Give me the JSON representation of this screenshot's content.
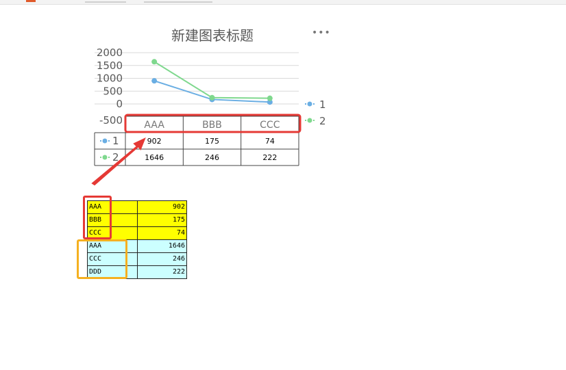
{
  "chart_data": {
    "type": "line",
    "title": "新建图表标题",
    "categories": [
      "AAA",
      "BBB",
      "CCC"
    ],
    "series": [
      {
        "name": "1",
        "values": [
          902,
          175,
          74
        ],
        "color": "#6aaee3"
      },
      {
        "name": "2",
        "values": [
          1646,
          246,
          222
        ],
        "color": "#7fd88e"
      }
    ],
    "y_ticks": [
      "2000",
      "1500",
      "1000",
      "500",
      "0",
      "-500"
    ],
    "ylim": [
      -500,
      2000
    ],
    "grid": true,
    "legend": "right",
    "data_table": true
  },
  "menu": {
    "more": "•••"
  },
  "sheet_table": {
    "rows": [
      {
        "key": "AAA",
        "value": "902",
        "fill": "#ffff00"
      },
      {
        "key": "BBB",
        "value": "175",
        "fill": "#ffff00"
      },
      {
        "key": "CCC",
        "value": "74",
        "fill": "#ffff00"
      },
      {
        "key": "AAA",
        "value": "1646",
        "fill": "#ccffff"
      },
      {
        "key": "CCC",
        "value": "246",
        "fill": "#ccffff"
      },
      {
        "key": "DDD",
        "value": "222",
        "fill": "#ccffff"
      }
    ]
  },
  "annotation_colors": {
    "red": "#e53935",
    "orange": "#f5b020"
  }
}
